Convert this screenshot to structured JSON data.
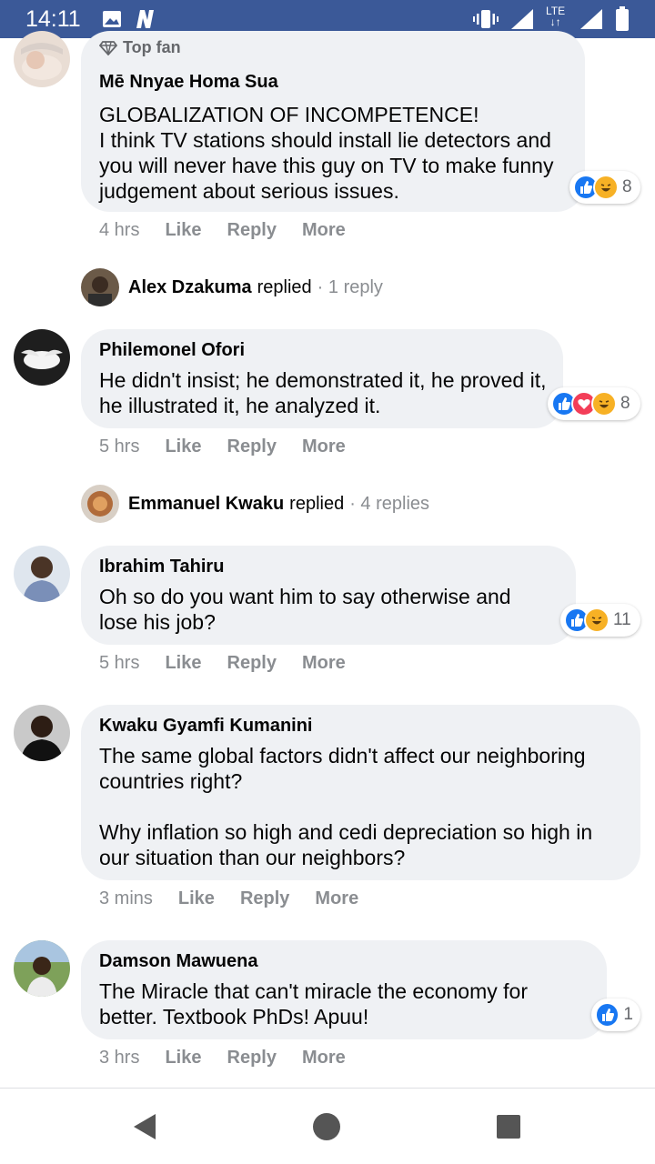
{
  "status_bar": {
    "time": "14:11",
    "network": "LTE"
  },
  "comments": [
    {
      "badge": "Top fan",
      "author": "Mē Nnyae Homa Sua",
      "text": "GLOBALIZATION OF INCOMPETENCE!\nI think TV stations should install lie detectors and you will never have this guy on TV to make funny judgement about serious issues.",
      "time": "4 hrs",
      "like": "Like",
      "reply": "Reply",
      "more": "More",
      "reaction_count": "8",
      "reply_summary": {
        "name": "Alex Dzakuma",
        "verb": "replied",
        "count": "· 1 reply"
      }
    },
    {
      "author": "Philemonel Ofori",
      "text": "He didn't insist; he demonstrated it, he proved it, he illustrated it, he analyzed it.",
      "time": "5 hrs",
      "like": "Like",
      "reply": "Reply",
      "more": "More",
      "reaction_count": "8",
      "reply_summary": {
        "name": "Emmanuel Kwaku",
        "verb": "replied",
        "count": "· 4 replies"
      }
    },
    {
      "author": "Ibrahim Tahiru",
      "text": "Oh so do you want him to say otherwise and lose his job?",
      "time": "5 hrs",
      "like": "Like",
      "reply": "Reply",
      "more": "More",
      "reaction_count": "11"
    },
    {
      "author": "Kwaku Gyamfi Kumanini",
      "text": "The same global factors didn't affect our neighboring countries right?\n\nWhy inflation so high and cedi depreciation so high in our situation than our neighbors?",
      "time": "3 mins",
      "like": "Like",
      "reply": "Reply",
      "more": "More"
    },
    {
      "author": "Damson Mawuena",
      "text": "The Miracle that can't miracle the economy for better. Textbook PhDs! Apuu!",
      "time": "3 hrs",
      "like": "Like",
      "reply": "Reply",
      "more": "More",
      "reaction_count": "1"
    }
  ],
  "colors": {
    "status_bar": "#3b5998",
    "bubble": "#eff1f4",
    "like_blue": "#1877f2",
    "muted": "#8a8d91"
  },
  "icons": [
    "gallery-icon",
    "n-app-icon",
    "vibrate-icon",
    "signal-icon",
    "lte-icon",
    "battery-icon",
    "diamond-icon",
    "like-reaction-icon",
    "love-reaction-icon",
    "haha-reaction-icon",
    "back-icon",
    "home-icon",
    "recents-icon"
  ]
}
